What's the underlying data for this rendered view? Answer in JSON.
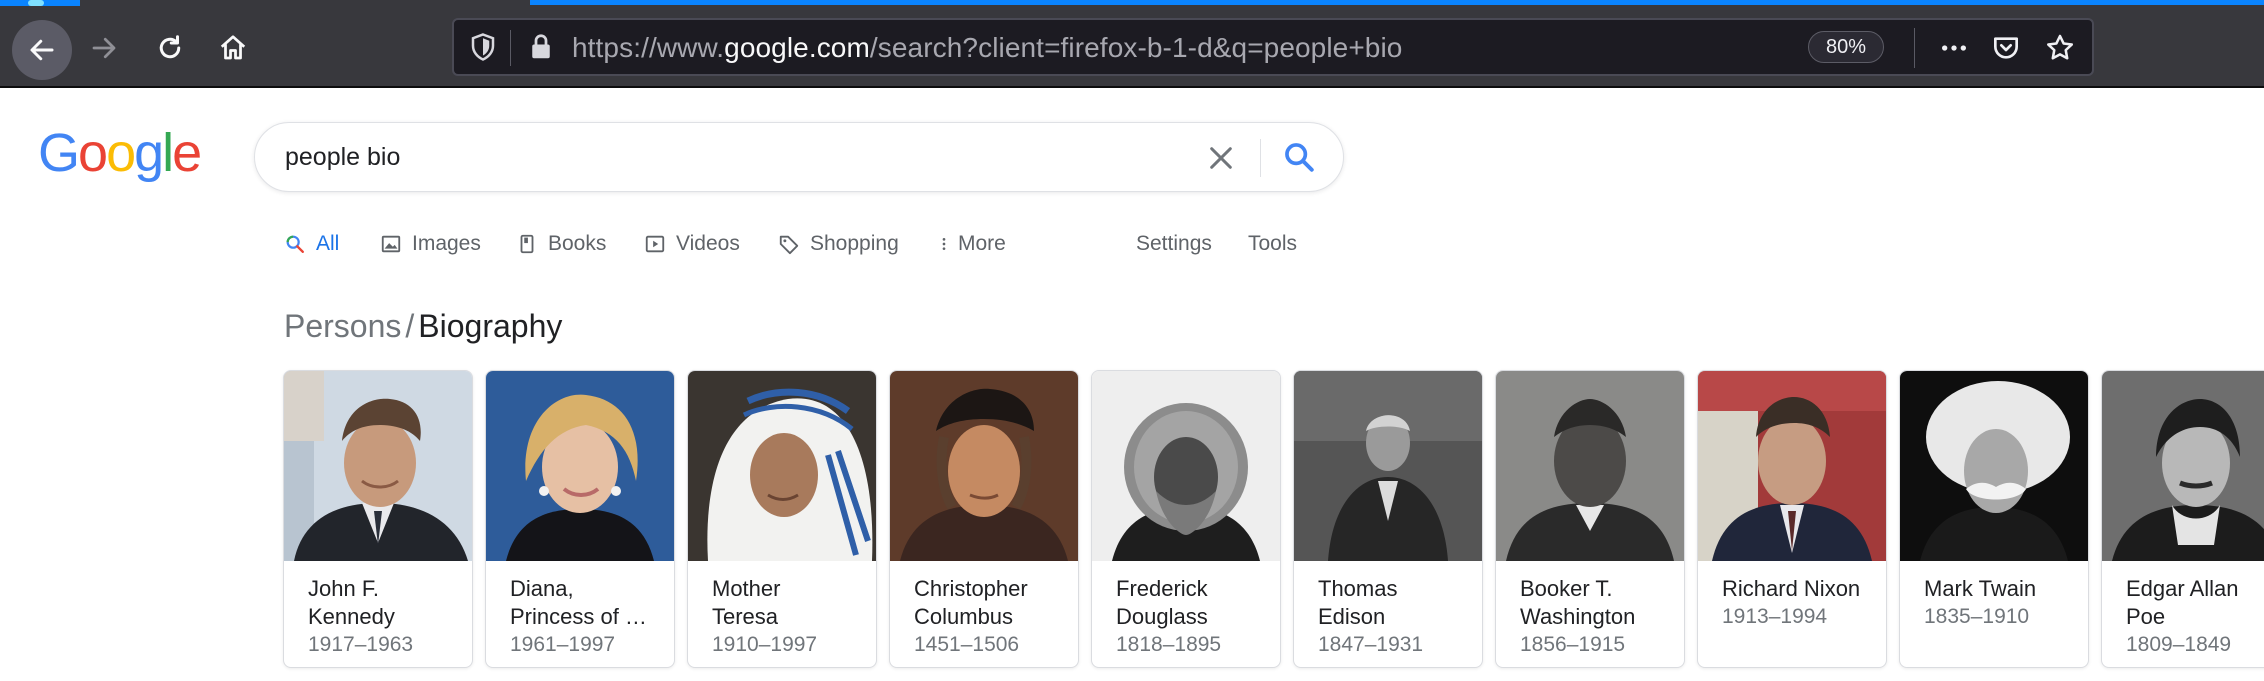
{
  "browser": {
    "url_prefix": "https://www.",
    "url_domain": "google.com",
    "url_path": "/search?client=firefox-b-1-d&q=people+bio",
    "zoom": "80%"
  },
  "google": {
    "logo_letters": [
      "G",
      "o",
      "o",
      "g",
      "l",
      "e"
    ],
    "logo_colors": [
      "#4285F4",
      "#EA4335",
      "#FBBC05",
      "#4285F4",
      "#34A853",
      "#EA4335"
    ],
    "search_value": "people bio"
  },
  "tabs": {
    "all": "All",
    "images": "Images",
    "books": "Books",
    "videos": "Videos",
    "shopping": "Shopping",
    "more": "More",
    "settings": "Settings",
    "tools": "Tools"
  },
  "heading": {
    "crumb": "Persons",
    "separator": "/",
    "title": "Biography"
  },
  "cards": [
    {
      "name1": "John F.",
      "name2": "Kennedy",
      "years": "1917–1963"
    },
    {
      "name1": "Diana,",
      "name2": "Princess of …",
      "years": "1961–1997"
    },
    {
      "name1": "Mother",
      "name2": "Teresa",
      "years": "1910–1997"
    },
    {
      "name1": "Christopher",
      "name2": "Columbus",
      "years": "1451–1506"
    },
    {
      "name1": "Frederick",
      "name2": "Douglass",
      "years": "1818–1895"
    },
    {
      "name1": "Thomas",
      "name2": "Edison",
      "years": "1847–1931"
    },
    {
      "name1": "Booker T.",
      "name2": "Washington",
      "years": "1856–1915"
    },
    {
      "name1": "Richard Nixon",
      "name2": "",
      "years": "1913–1994"
    },
    {
      "name1": "Mark Twain",
      "name2": "",
      "years": "1835–1910"
    },
    {
      "name1": "Edgar Allan",
      "name2": "Poe",
      "years": "1809–1849"
    }
  ]
}
